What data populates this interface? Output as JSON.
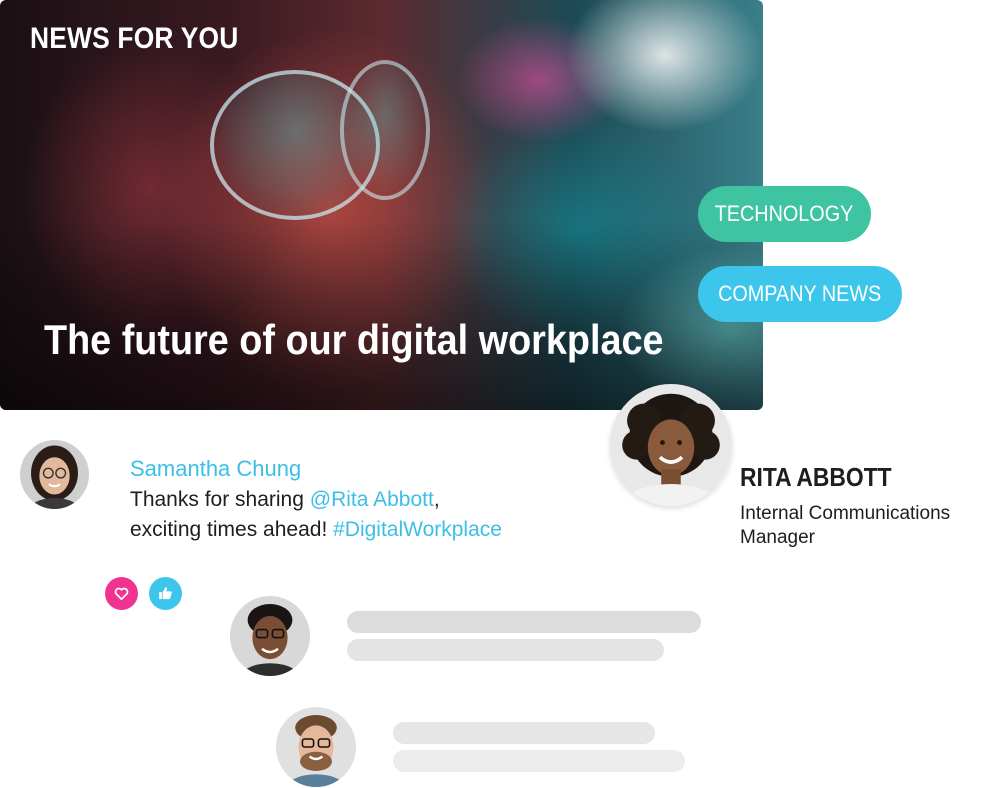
{
  "hero": {
    "eyebrow": "NEWS FOR YOU",
    "title": "The future of our digital workplace"
  },
  "tags": [
    {
      "label": "TECHNOLOGY",
      "color": "#3ec4a0"
    },
    {
      "label": "COMPANY NEWS",
      "color": "#3cc6ec"
    }
  ],
  "author": {
    "name": "RITA ABBOTT",
    "role": "Internal Communications Manager"
  },
  "comment": {
    "author": "Samantha Chung",
    "line1_prefix": "Thanks for sharing ",
    "mention": "@Rita Abbott",
    "line1_suffix": ",",
    "line2_prefix": "exciting times ahead! ",
    "hashtag": "#DigitalWorkplace"
  },
  "reactions": [
    {
      "icon": "heart-icon",
      "color": "#f0338f"
    },
    {
      "icon": "thumbs-up-icon",
      "color": "#3cc6ec"
    }
  ],
  "colors": {
    "accent_blue": "#3cc6ec",
    "accent_green": "#3ec4a0",
    "accent_pink": "#f0338f",
    "text": "#1e1e1e"
  }
}
